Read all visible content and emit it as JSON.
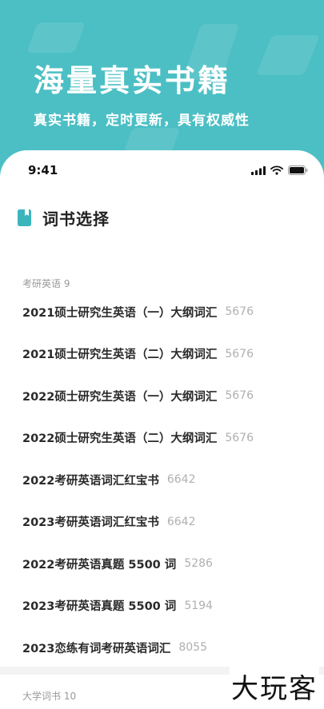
{
  "banner": {
    "title": "海量真实书籍",
    "subtitle": "真实书籍，定时更新，具有权威性"
  },
  "status_bar": {
    "time": "9:41",
    "icons": [
      "signal-icon",
      "wifi-icon",
      "battery-icon"
    ]
  },
  "header": {
    "icon": "book-icon",
    "title": "词书选择"
  },
  "sections": [
    {
      "label": "考研英语 9",
      "items": [
        {
          "name": "2021硕士研究生英语（一）大纲词汇",
          "count": "5676"
        },
        {
          "name": "2021硕士研究生英语（二）大纲词汇",
          "count": "5676"
        },
        {
          "name": "2022硕士研究生英语（一）大纲词汇",
          "count": "5676"
        },
        {
          "name": "2022硕士研究生英语（二）大纲词汇",
          "count": "5676"
        },
        {
          "name": "2022考研英语词汇红宝书",
          "count": "6642"
        },
        {
          "name": "2023考研英语词汇红宝书",
          "count": "6642"
        },
        {
          "name": "2022考研英语真题 5500 词",
          "count": "5286"
        },
        {
          "name": "2023考研英语真题 5500 词",
          "count": "5194"
        },
        {
          "name": "2023恋练有词考研英语词汇",
          "count": "8055"
        }
      ]
    },
    {
      "label": "大学词书 10",
      "items": []
    }
  ],
  "watermark": "大玩客",
  "colors": {
    "banner_bg": "#4BBFC4",
    "accent": "#3BB5BB",
    "item_text": "#2a2a2a",
    "count_text": "#b0b0b0"
  }
}
